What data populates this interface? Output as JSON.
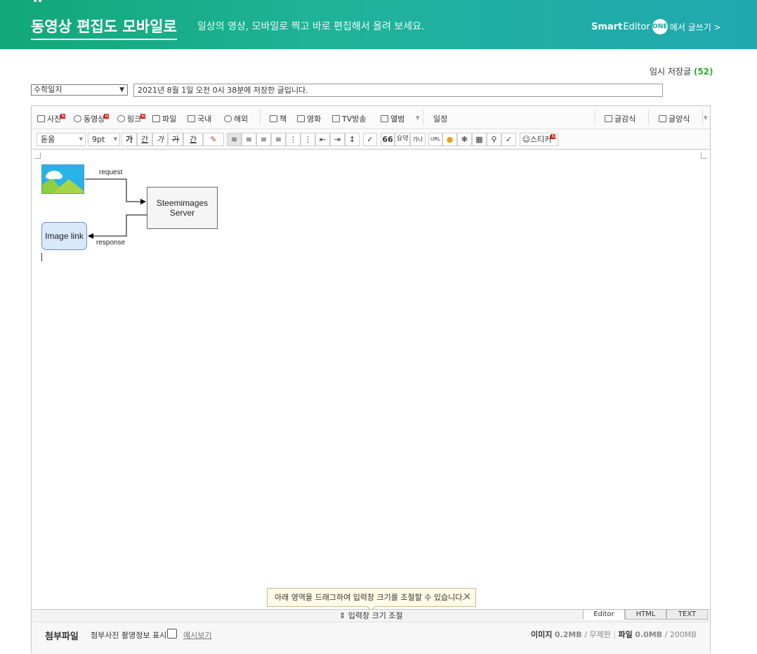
{
  "banner": {
    "quote": "“",
    "title": "동영상 편집도 모바일로",
    "subtitle": "일상의 영상, 모바일로 찍고 바로 편집해서 올려 보세요.",
    "brand_smart": "Smart",
    "brand_editor": "Editor",
    "brand_one": "ONE",
    "write_link": "에서 글쓰기 >"
  },
  "temp_save": {
    "label": "임시 저장글",
    "count": "(52)"
  },
  "category": {
    "selected": "수학일지"
  },
  "save_info": "2021년 8월 1일 오전 0시 38분에 저장한 글입니다.",
  "toolbar1": {
    "items": [
      "사진",
      "동영상",
      "링크",
      "파일",
      "국내",
      "해외",
      "책",
      "영화",
      "TV방송",
      "앨범",
      "일정"
    ],
    "template": "글감식",
    "layout": "글양식"
  },
  "toolbar2": {
    "font": "돋움",
    "size": "9pt",
    "bold": "가",
    "underline": "간",
    "italic": "가",
    "strike": "가",
    "color": "간",
    "quote": "66",
    "summary": "요약",
    "charset": "가나",
    "url": "URL",
    "sticker": "스티커"
  },
  "diagram": {
    "server": [
      "Steemimages",
      "Server"
    ],
    "image_link": "Image link",
    "request": "request",
    "response": "response"
  },
  "tooltip": "아래 영역을 드래그하여 입력창 크기를 조절할 수 있습니다.",
  "resize_label": "입력창 크기 조절",
  "mode_tabs": [
    "Editor",
    "HTML",
    "TEXT"
  ],
  "attach": {
    "title": "첨부파일",
    "exif": "첨부사진 촬영정보 표시",
    "sample": "예시보기",
    "image_label": "이미지",
    "image_value": "0.2MB",
    "image_limit": "무제한",
    "file_label": "파일",
    "file_value": "0.0MB",
    "file_limit": "200MB"
  },
  "colors": {
    "banner_start": "#12a877",
    "banner_end": "#20a8b0",
    "count_green": "#2eac2e",
    "badge_red": "#d71d1d"
  }
}
